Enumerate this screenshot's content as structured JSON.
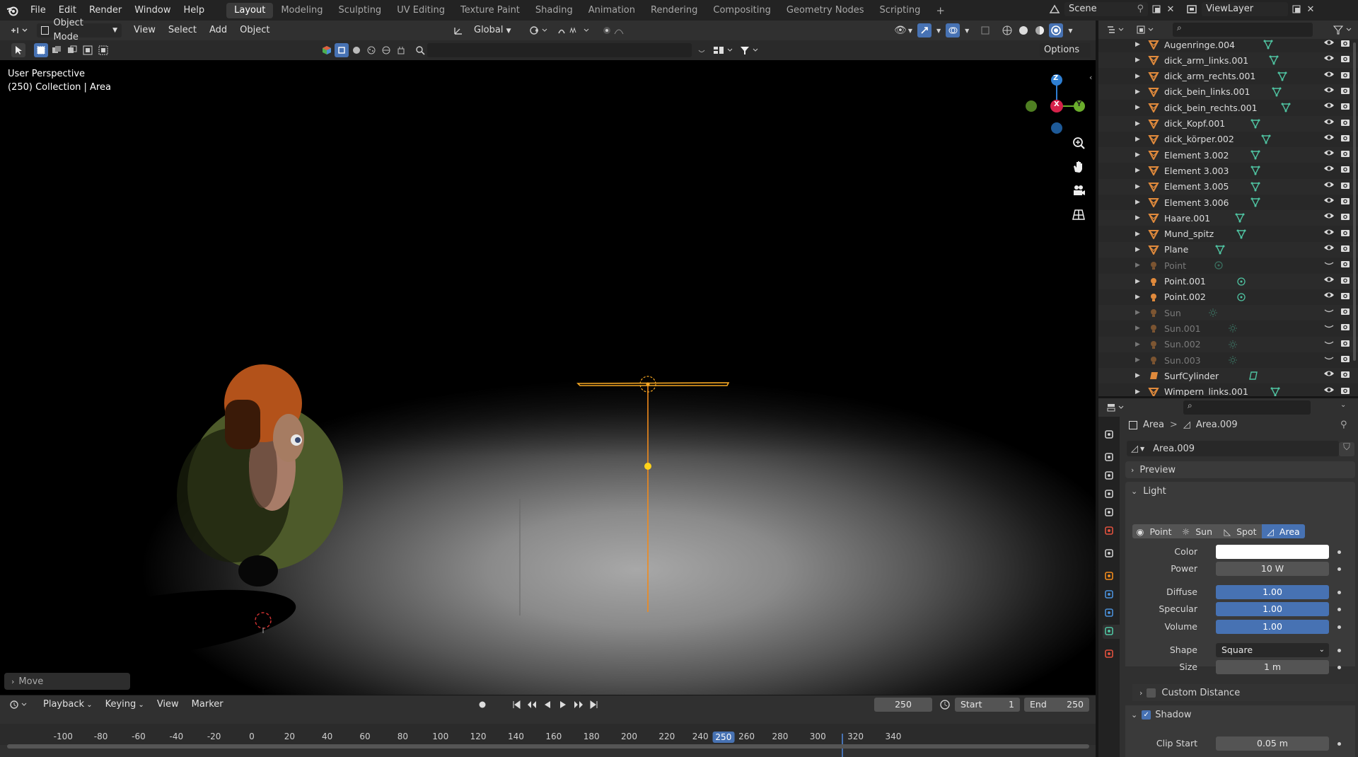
{
  "topbar": {
    "menus": [
      "File",
      "Edit",
      "Render",
      "Window",
      "Help"
    ],
    "workspaces": [
      "Layout",
      "Modeling",
      "Sculpting",
      "UV Editing",
      "Texture Paint",
      "Shading",
      "Animation",
      "Rendering",
      "Compositing",
      "Geometry Nodes",
      "Scripting"
    ],
    "active_workspace": "Layout",
    "add_tab": "+",
    "scene": "Scene",
    "view_layer": "ViewLayer"
  },
  "viewport_header": {
    "mode": "Object Mode",
    "menus": [
      "View",
      "Select",
      "Add",
      "Object"
    ],
    "orientation": "Global",
    "options": "Options"
  },
  "viewport": {
    "perspective": "User Perspective",
    "collection": "(250) Collection | Area",
    "last_op": "Move",
    "gizmo": {
      "z": "Z",
      "x": "X",
      "y": "Y"
    }
  },
  "timeline": {
    "menus": [
      "Playback",
      "Keying",
      "View",
      "Marker"
    ],
    "current_frame": "250",
    "start_label": "Start",
    "start": "1",
    "end_label": "End",
    "end": "250",
    "ruler": [
      "-100",
      "-80",
      "-60",
      "-40",
      "-20",
      "0",
      "20",
      "40",
      "60",
      "80",
      "100",
      "120",
      "140",
      "160",
      "180",
      "200",
      "220",
      "240",
      "250",
      "260",
      "280",
      "300",
      "320",
      "340"
    ]
  },
  "outliner": {
    "items": [
      {
        "name": "Augenringe.004",
        "type": "mesh",
        "visible": true
      },
      {
        "name": "dick_arm_links.001",
        "type": "mesh",
        "visible": true
      },
      {
        "name": "dick_arm_rechts.001",
        "type": "mesh",
        "visible": true
      },
      {
        "name": "dick_bein_links.001",
        "type": "mesh",
        "visible": true
      },
      {
        "name": "dick_bein_rechts.001",
        "type": "mesh",
        "visible": true
      },
      {
        "name": "dick_Kopf.001",
        "type": "mesh",
        "visible": true
      },
      {
        "name": "dick_körper.002",
        "type": "mesh",
        "visible": true
      },
      {
        "name": "Element 3.002",
        "type": "mesh",
        "visible": true
      },
      {
        "name": "Element 3.003",
        "type": "mesh",
        "visible": true
      },
      {
        "name": "Element 3.005",
        "type": "mesh",
        "visible": true
      },
      {
        "name": "Element 3.006",
        "type": "mesh",
        "visible": true
      },
      {
        "name": "Haare.001",
        "type": "mesh",
        "visible": true
      },
      {
        "name": "Mund_spitz",
        "type": "mesh",
        "visible": true
      },
      {
        "name": "Plane",
        "type": "mesh",
        "visible": true
      },
      {
        "name": "Point",
        "type": "light",
        "visible": false
      },
      {
        "name": "Point.001",
        "type": "light",
        "visible": true
      },
      {
        "name": "Point.002",
        "type": "light",
        "visible": true
      },
      {
        "name": "Sun",
        "type": "sun",
        "visible": false
      },
      {
        "name": "Sun.001",
        "type": "sun",
        "visible": false
      },
      {
        "name": "Sun.002",
        "type": "sun",
        "visible": false
      },
      {
        "name": "Sun.003",
        "type": "sun",
        "visible": false
      },
      {
        "name": "SurfCylinder",
        "type": "surface",
        "visible": true
      },
      {
        "name": "Wimpern_links.001",
        "type": "mesh",
        "visible": true
      }
    ]
  },
  "properties": {
    "breadcrumb_object": "Area",
    "breadcrumb_sep": ">",
    "breadcrumb_data": "Area.009",
    "datablock": "Area.009",
    "preview": "Preview",
    "light_panel": "Light",
    "light_types": [
      "Point",
      "Sun",
      "Spot",
      "Area"
    ],
    "active_light_type": "Area",
    "color_label": "Color",
    "power_label": "Power",
    "power": "10 W",
    "diffuse_label": "Diffuse",
    "diffuse": "1.00",
    "specular_label": "Specular",
    "specular": "1.00",
    "volume_label": "Volume",
    "volume": "1.00",
    "shape_label": "Shape",
    "shape": "Square",
    "size_label": "Size",
    "size": "1 m",
    "custom_distance": "Custom Distance",
    "shadow": "Shadow",
    "clip_start_label": "Clip Start",
    "clip_start": "0.05 m"
  },
  "colors": {
    "accent": "#4772b3",
    "selected": "#f5a623",
    "light_green": "#4fc3a1",
    "mesh_orange": "#e08a3c"
  }
}
